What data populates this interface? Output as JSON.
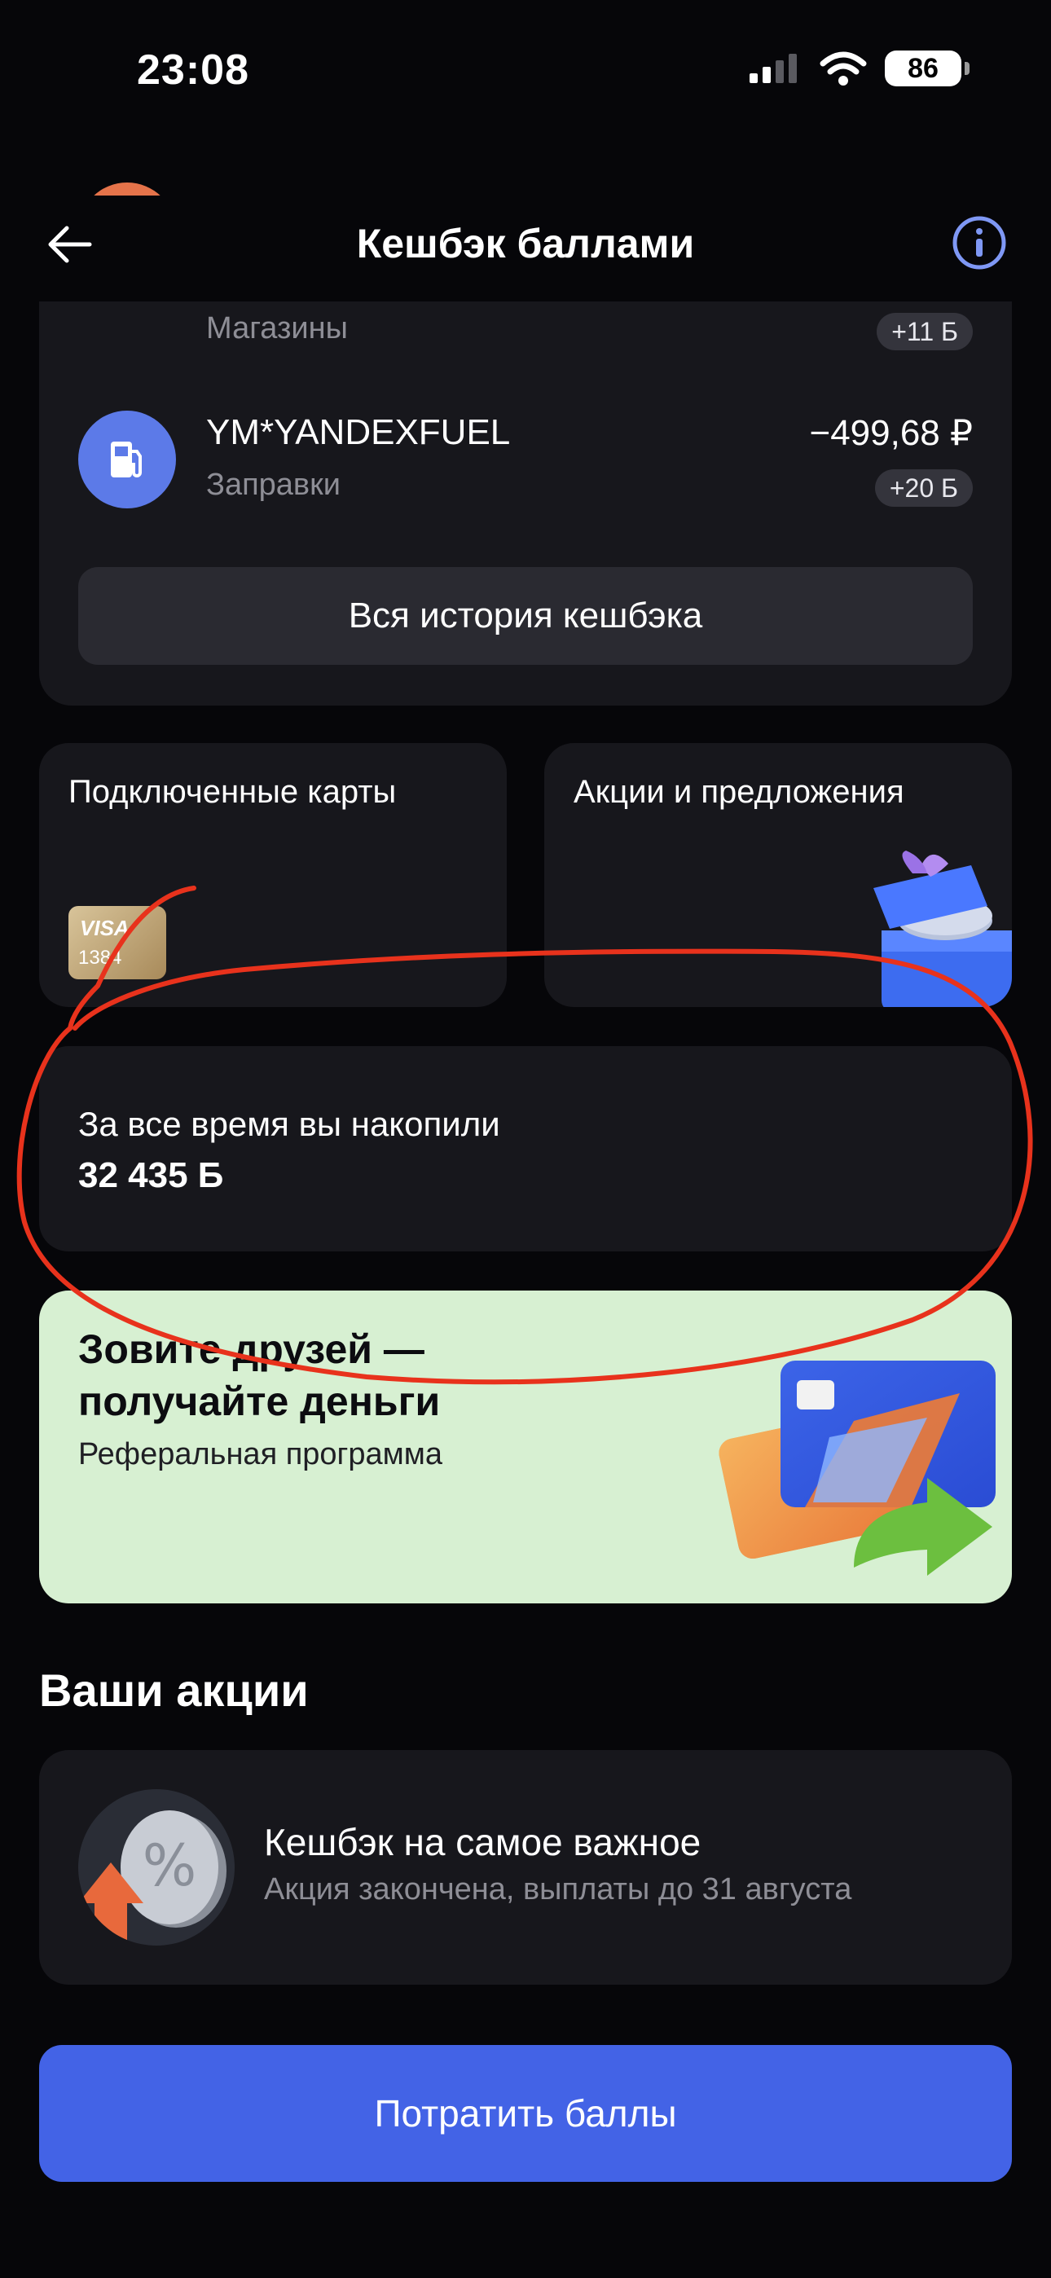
{
  "status_bar": {
    "time": "23:08",
    "battery": "86"
  },
  "nav": {
    "title": "Кешбэк баллами"
  },
  "history": {
    "rows": [
      {
        "title": "",
        "category": "Магазины",
        "amount": "",
        "points": "+11 Б"
      },
      {
        "title": "YM*YANDEXFUEL",
        "category": "Заправки",
        "amount": "−499,68 ₽",
        "points": "+20 Б"
      }
    ],
    "all_history_label": "Вся история кешбэка"
  },
  "tiles": {
    "connected_cards": {
      "title": "Подключенные карты",
      "card_brand": "VISA",
      "card_number": "1384"
    },
    "offers": {
      "title": "Акции и предложения"
    }
  },
  "accumulated": {
    "label": "За все время вы накопили",
    "value": "32 435 Б"
  },
  "referral": {
    "title": "Зовите друзей — получайте деньги",
    "subtitle": "Реферальная программа"
  },
  "promotions": {
    "section_title": "Ваши акции",
    "items": [
      {
        "title": "Кешбэк на самое важное",
        "subtitle": "Акция закончена, выплаты до 31 августа"
      }
    ]
  },
  "spend_button": {
    "label": "Потратить баллы"
  },
  "colors": {
    "accent": "#4363e6",
    "card_bg": "#17171c",
    "referral_bg": "#d7f0d2",
    "annotation": "#e8321c"
  }
}
